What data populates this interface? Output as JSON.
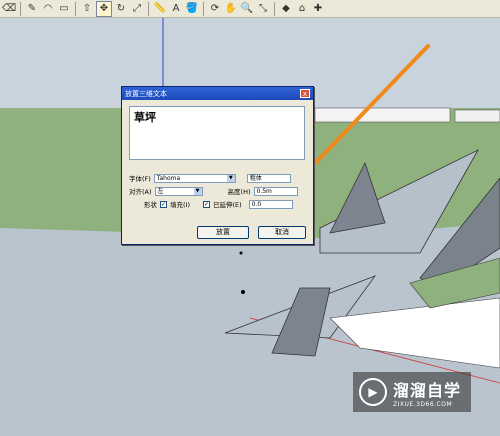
{
  "toolbar": {
    "icons": [
      "eraser-icon",
      "pencil-icon",
      "arc-icon",
      "rectangle-icon",
      "pushpull-icon",
      "rotate-icon",
      "move-icon",
      "followme-icon",
      "scale-icon",
      "tape-icon",
      "text3d-icon",
      "paint-icon",
      "orbit-icon",
      "pan-icon",
      "zoom-icon",
      "zoomext-icon",
      "ruby-icon",
      "warehouse-icon",
      "extension-icon"
    ]
  },
  "dialog": {
    "title": "放置三维文本",
    "close_symbol": "x",
    "text_value": "草坪",
    "font_label": "字体(F)",
    "font_value": "Tahoma",
    "weight_value": "粗体",
    "align_label": "对齐(A)",
    "align_value": "左",
    "height_label": "高度(H)",
    "height_value": "0.5m",
    "shape_label": "形状",
    "fill_label": "填充(I)",
    "extruded_label": "已延伸(E)",
    "extrude_value": "0.0",
    "place_button": "放置",
    "cancel_button": "取消",
    "fill_checked": true,
    "extruded_checked": true
  },
  "watermark": {
    "brand": "溜溜自学",
    "url": "ZIXUE.3D66.COM"
  },
  "colors": {
    "sky": "#c9d3dd",
    "grass": "#8fb17e",
    "arrow": "#f08a1c"
  }
}
